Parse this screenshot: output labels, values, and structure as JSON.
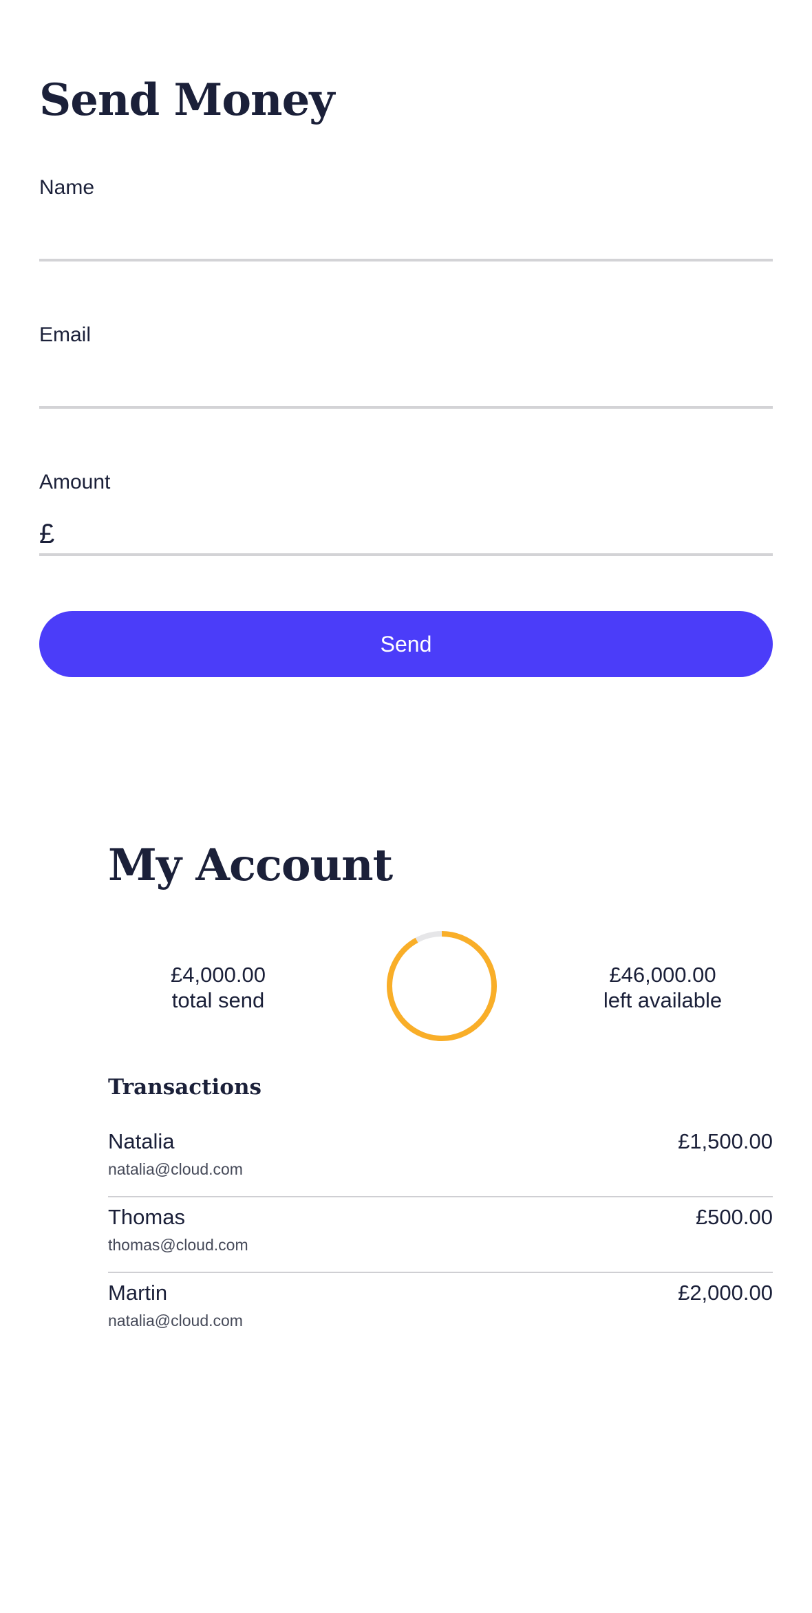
{
  "send_money": {
    "title": "Send Money",
    "fields": {
      "name": {
        "label": "Name",
        "value": ""
      },
      "email": {
        "label": "Email",
        "value": ""
      },
      "amount": {
        "label": "Amount",
        "currency_symbol": "£",
        "value": ""
      }
    },
    "send_label": "Send"
  },
  "account": {
    "title": "My Account",
    "total_send": {
      "amount": "£4,000.00",
      "label": "total send"
    },
    "left_available": {
      "amount": "£46,000.00",
      "label": "left available"
    },
    "usage_ring": {
      "used_fraction": 0.92,
      "used_color": "#f9ae28",
      "track_color": "#e6e6e8"
    },
    "transactions_heading": "Transactions",
    "transactions": [
      {
        "name": "Natalia",
        "email": "natalia@cloud.com",
        "amount": "£1,500.00"
      },
      {
        "name": "Thomas",
        "email": "thomas@cloud.com",
        "amount": "£500.00"
      },
      {
        "name": "Martin",
        "email": "natalia@cloud.com",
        "amount": "£2,000.00"
      }
    ]
  },
  "colors": {
    "accent": "#4b3df9",
    "text": "#1b2039",
    "ring": "#f9ae28"
  }
}
